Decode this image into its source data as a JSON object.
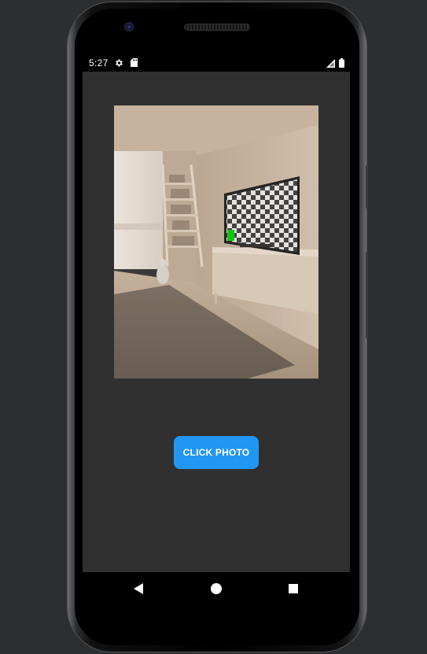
{
  "status_bar": {
    "time": "5:27",
    "icons": [
      "gear-icon",
      "sd-card-icon",
      "signal-icon",
      "battery-icon"
    ]
  },
  "main": {
    "photo": {
      "description_icon": "room-photo",
      "accent_color": "#00c800"
    },
    "click_button_label": "CLICK PHOTO",
    "button_color": "#2196f3"
  },
  "nav_bar": {
    "icons": [
      "back-icon",
      "home-icon",
      "recents-icon"
    ]
  }
}
